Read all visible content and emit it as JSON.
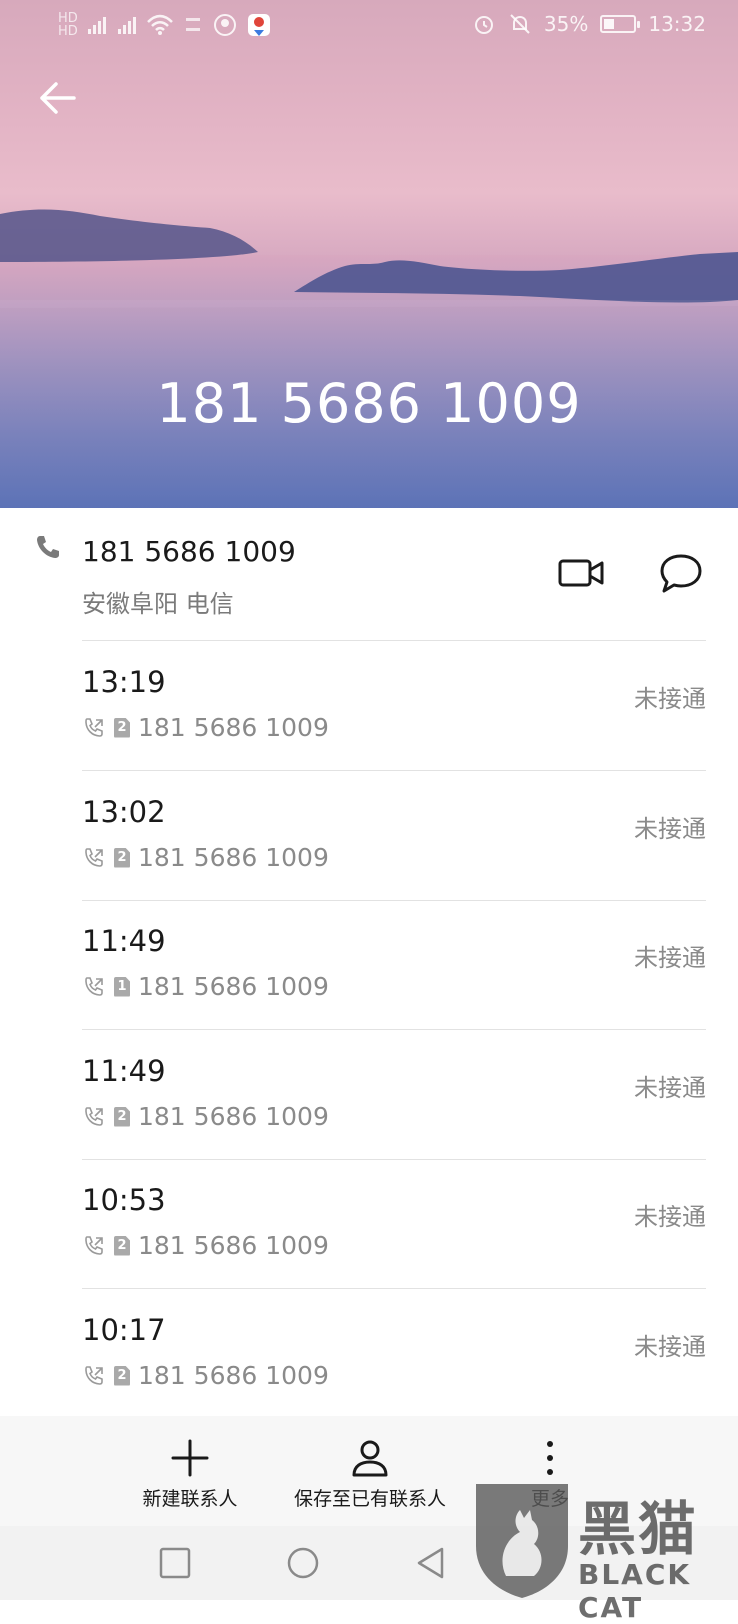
{
  "status_bar": {
    "battery_percent": "35%",
    "time": "13:32",
    "battery_level": 0.35,
    "left_icons": [
      "hd-icon",
      "signal-4g-icon",
      "signal-icon",
      "wifi-icon",
      "data-speed-icon",
      "app-notification-icon",
      "maps-notification-icon"
    ],
    "right_icons": [
      "alarm-icon",
      "mute-icon",
      "battery-icon"
    ]
  },
  "header": {
    "number": "181 5686 1009"
  },
  "contact": {
    "number": "181 5686 1009",
    "location": "安徽阜阳 电信"
  },
  "calls": [
    {
      "time": "13:19",
      "sim": "2",
      "number": "181 5686 1009",
      "status": "未接通"
    },
    {
      "time": "13:02",
      "sim": "2",
      "number": "181 5686 1009",
      "status": "未接通"
    },
    {
      "time": "11:49",
      "sim": "1",
      "number": "181 5686 1009",
      "status": "未接通"
    },
    {
      "time": "11:49",
      "sim": "2",
      "number": "181 5686 1009",
      "status": "未接通"
    },
    {
      "time": "10:53",
      "sim": "2",
      "number": "181 5686 1009",
      "status": "未接通"
    },
    {
      "time": "10:17",
      "sim": "2",
      "number": "181 5686 1009",
      "status": "未接通"
    }
  ],
  "actions": {
    "new_contact": "新建联系人",
    "save_existing": "保存至已有联系人",
    "more": "更多"
  },
  "watermark": {
    "cn": "黑猫",
    "en": "BLACK CAT"
  },
  "colors": {
    "accent_text": "#1a1a1a",
    "secondary_text": "#8a8a8a",
    "divider": "#e2e2e2"
  }
}
